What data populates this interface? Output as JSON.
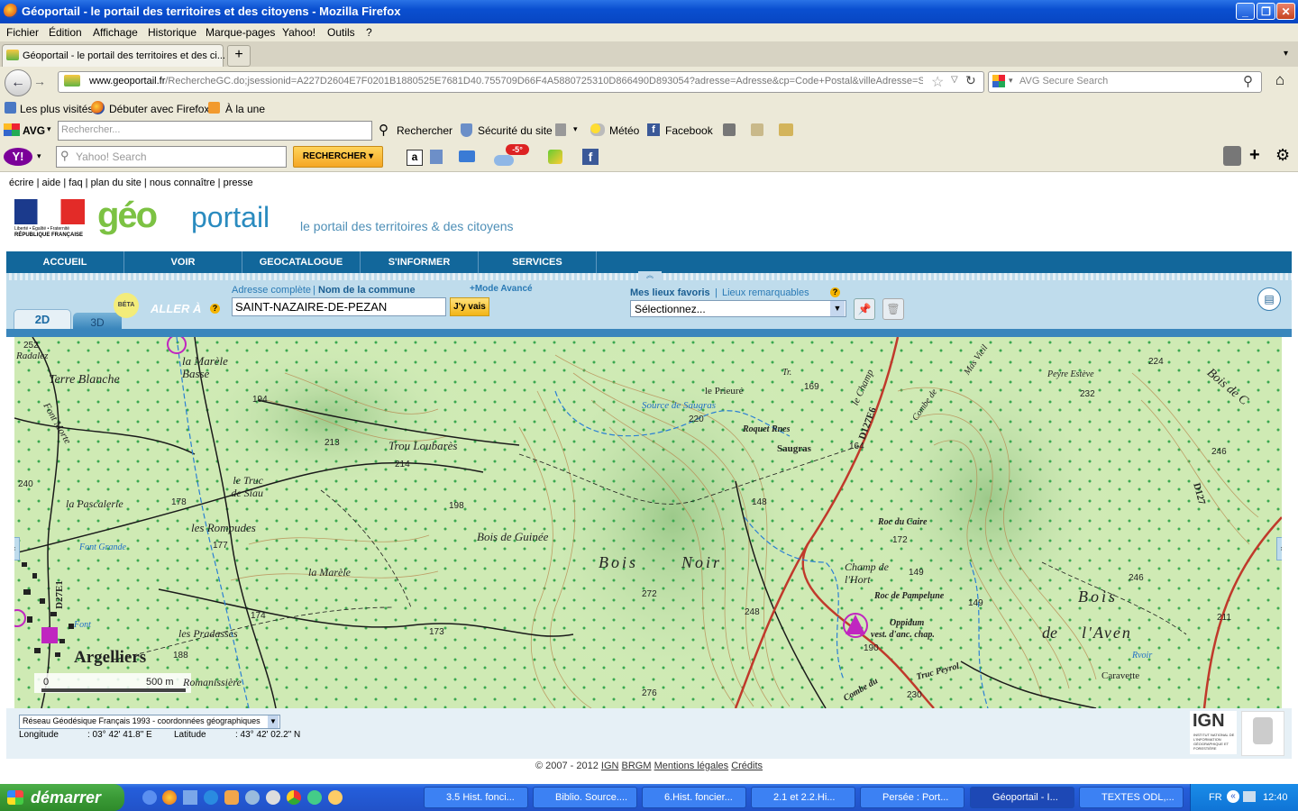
{
  "window": {
    "title": "Géoportail - le portail des territoires et des citoyens - Mozilla Firefox"
  },
  "menu": [
    "Fichier",
    "Édition",
    "Affichage",
    "Historique",
    "Marque-pages",
    "Yahoo!",
    "Outils",
    "?"
  ],
  "tab": {
    "label": "Géoportail - le portail des territoires et des ci...",
    "new_tab": "+"
  },
  "nav": {
    "url_prefix": "www.geoportail.fr",
    "url_rest": "/RechercheGC.do;jsessionid=A227D2604E7F0201B1880525E7681D40.755709D66F4A5880725310D866490D893054?adresse=Adresse&cp=Code+Postal&villeAdresse=Saint+",
    "search_placeholder": "AVG Secure Search"
  },
  "bookmarks": [
    "Les plus visités",
    "Débuter avec Firefox",
    "À la une"
  ],
  "avg_toolbar": {
    "brand": "AVG",
    "search_placeholder": "Rechercher...",
    "search_btn": "Rechercher",
    "security": "Sécurité du site",
    "weather": "Météo",
    "facebook": "Facebook"
  },
  "yahoo_toolbar": {
    "search_placeholder": "Yahoo! Search",
    "search_btn": "RECHERCHER",
    "temp": "-5°"
  },
  "page": {
    "toplinks": [
      "écrire",
      "aide",
      "faq",
      "plan du site",
      "nous connaître",
      "presse"
    ],
    "logo_rf": [
      "Liberté • Égalité • Fraternité",
      "RÉPUBLIQUE FRANÇAISE"
    ],
    "logo_geo": "géo",
    "logo_portail": "portail",
    "tagline": "le portail des territoires & des citoyens",
    "navtabs": [
      "ACCUEIL",
      "VOIR",
      "GEOCATALOGUE",
      "S'INFORMER",
      "SERVICES"
    ],
    "tab2d": "2D",
    "tab3d": "3D",
    "beta": "BÉTA",
    "aller": "ALLER À",
    "addr_full": "Adresse complète",
    "addr_commune": "Nom de la commune",
    "mode_avance": "+Mode Avancé",
    "address_value": "SAINT-NAZAIRE-DE-PEZAN",
    "go": "J'y vais",
    "fav_label": "Mes lieux favoris",
    "fav_remarkable": "Lieux remarquables",
    "fav_select": "Sélectionnez...",
    "help": "?",
    "scale_0": "0",
    "scale_500": "500 m",
    "crs": "Réseau Géodésique Français 1993 - coordonnées géographiques",
    "lon_label": "Longitude",
    "lon_value": ": 03° 42' 41.8\" E",
    "lat_label": "Latitude",
    "lat_value": ": 43° 42' 02.2\" N",
    "ign": "IGN",
    "ign_sub": "INSTITUT NATIONAL DE L'INFORMATION GÉOGRAPHIQUE ET FORESTIÈRE",
    "copyright": "© 2007 - 2012",
    "copyright_links": [
      "IGN",
      "BRGM",
      "Mentions légales",
      "Crédits"
    ]
  },
  "map_labels": {
    "places": [
      "Radalez",
      "Terre Blanche",
      "la Marèle Basse",
      "Trou Loubarès",
      "le Prieuré",
      "Source de Saugras",
      "Roquet Rnes",
      "Saugras",
      "Peyre Estève",
      "Bois de C",
      "le Truc de Siau",
      "la Pascalerie",
      "les Rompudes",
      "Bois de Guinée",
      "Font Grande",
      "la Marèle",
      "Roc du Caire",
      "Champ de l'Hort",
      "Roc de Pampelune",
      "Oppidum",
      "vest. d'anc. chap.",
      "les Pradasses",
      "Argelliers",
      "Romanissière",
      "Caravette",
      "Rvoir",
      "Font",
      "Truc Peyrol",
      "Combe du",
      "Tr.",
      "Mas Vieil",
      "Combe de",
      "le Champ",
      "Font Morte"
    ],
    "big": [
      "Bois",
      "Noir",
      "Bois",
      "de",
      "l'Aven"
    ],
    "roads": [
      "D127E6",
      "D127",
      "D27E1"
    ],
    "heights": [
      "252",
      "194",
      "213",
      "214",
      "220",
      "169",
      "164",
      "232",
      "224",
      "246",
      "198",
      "178",
      "177",
      "148",
      "172",
      "149",
      "246",
      "174",
      "173",
      "272",
      "248",
      "149",
      "190",
      "211",
      "276",
      "230",
      "188",
      "240"
    ]
  },
  "taskbar": {
    "start": "démarrer",
    "buttons": [
      "3.5 Hist. fonci...",
      "Biblio. Source....",
      "6.Hist. foncier...",
      "2.1 et  2.2.Hi...",
      "Persée : Port...",
      "Géoportail - I...",
      "TEXTES ODL,..."
    ],
    "lang": "FR",
    "clock": "12:40"
  }
}
